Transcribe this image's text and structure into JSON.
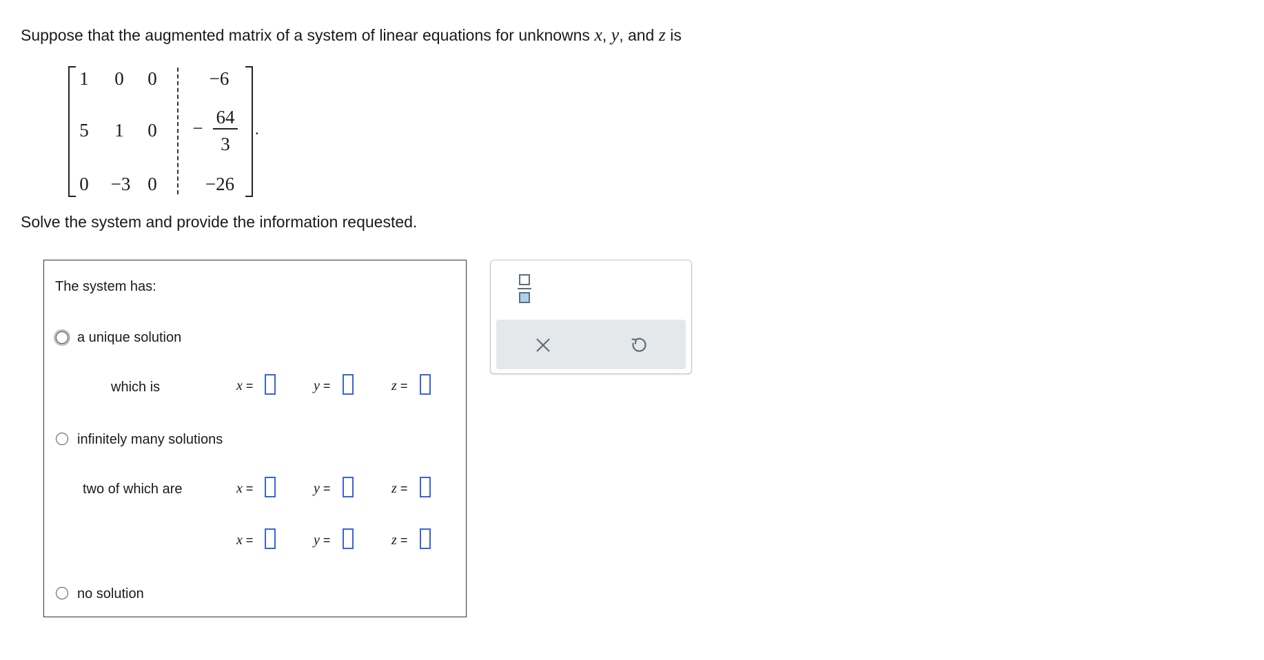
{
  "question": {
    "intro": "Suppose that the augmented matrix of a system of linear equations for unknowns ",
    "var_x": "x",
    "comma1": ", ",
    "var_y": "y",
    "comma2": ", and ",
    "var_z": "z",
    "intro_end": " is",
    "period": ".",
    "instruction": "Solve the system and provide the information requested."
  },
  "matrix": {
    "r1": [
      "1",
      "0",
      "0",
      "−6"
    ],
    "r2": [
      "5",
      "1",
      "0"
    ],
    "r2_aug": {
      "sign": "−",
      "numerator": "64",
      "denominator": "3"
    },
    "r3": [
      "0",
      "−3",
      "0",
      "−26"
    ]
  },
  "panel": {
    "heading": "The system has:",
    "options": {
      "unique": "a unique solution",
      "infinite": "infinitely many solutions",
      "none": "no solution"
    },
    "unique_sub": "which is",
    "infinite_sub": "two of which are",
    "eq": {
      "x": "x",
      "y": "y",
      "z": "z",
      "equals": "="
    }
  },
  "toolbar": {
    "fraction_icon": "fraction-icon",
    "clear_icon": "x-icon",
    "undo_icon": "undo-icon"
  },
  "colors": {
    "input_border": "#3a63d8",
    "toolbar_bg": "#e5e8eb",
    "fraction_icon_fill": "#a9d3ea",
    "icon_stroke": "#5f6d78"
  }
}
